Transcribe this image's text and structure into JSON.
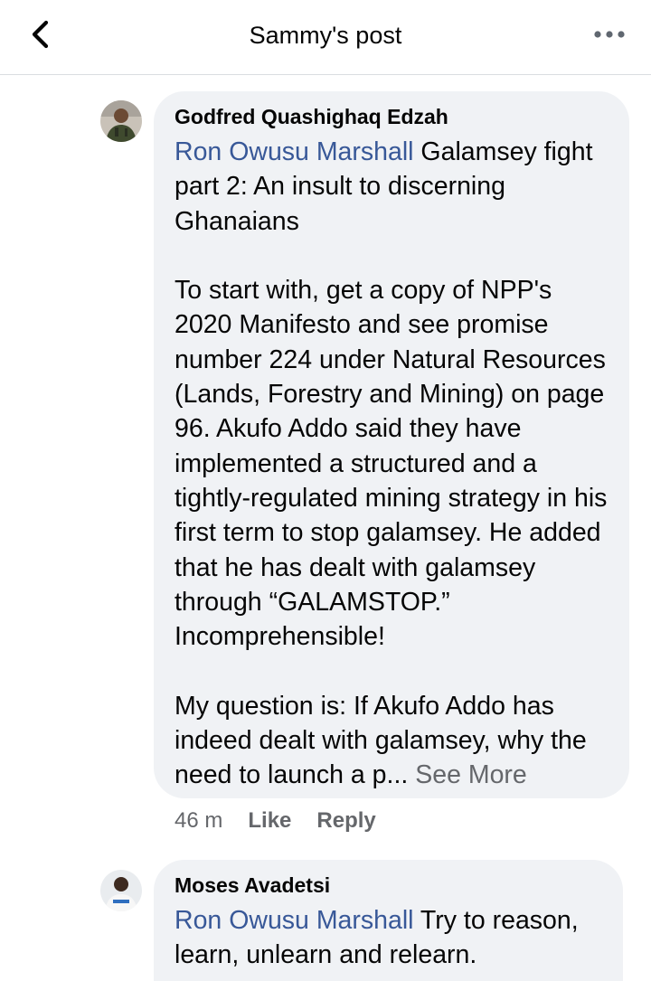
{
  "header": {
    "title": "Sammy's post",
    "back_icon": "chevron-left-icon",
    "more_icon": "more-horizontal-icon"
  },
  "comments": [
    {
      "author": "Godfred Quashighaq Edzah",
      "mention": "Ron Owusu Marshall",
      "body": " Galamsey fight part 2: An insult to discerning Ghanaians\n\nTo start with, get a copy of NPP's 2020 Manifesto and see promise number 224 under Natural Resources (Lands, Forestry and Mining) on page 96. Akufo Addo said they have implemented a structured and a tightly-regulated mining strategy in his first term to stop galamsey. He added that he has dealt with galamsey through “GALAMSTOP.” Incomprehensible!\n\nMy question is: If Akufo Addo has indeed dealt with galamsey, why the need to launch a p... ",
      "see_more": "See More",
      "time": "46 m",
      "like": "Like",
      "reply": "Reply"
    },
    {
      "author": "Moses Avadetsi",
      "mention": "Ron Owusu Marshall",
      "body": " Try to reason, learn, unlearn and relearn."
    }
  ],
  "colors": {
    "bubble": "#f0f2f5",
    "mention": "#385898",
    "meta": "#65676b",
    "text": "#050505"
  }
}
